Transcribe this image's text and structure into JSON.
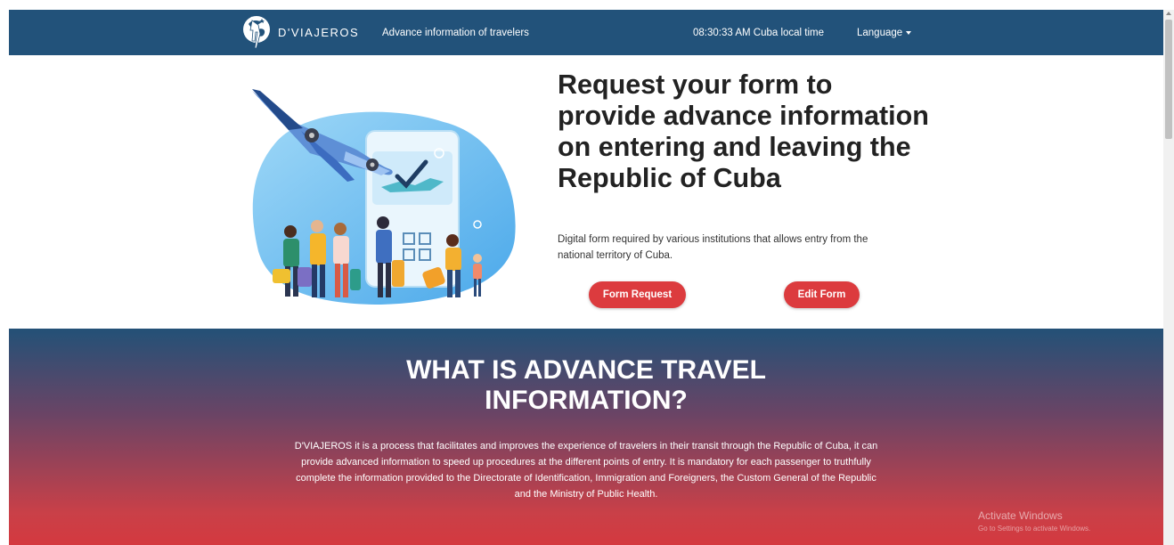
{
  "navbar": {
    "brand_name": "D'VIAJEROS",
    "tagline": "Advance information of travelers",
    "clock": "08:30:33 AM Cuba local time",
    "language_label": "Language",
    "background_color": "#22527a"
  },
  "hero": {
    "title": "Request your form to provide advance information on entering and leaving the Republic of Cuba",
    "description": "Digital form required by various institutions that allows entry from the national territory of Cuba.",
    "buttons": {
      "form_request": "Form Request",
      "edit_form": "Edit Form"
    },
    "button_color": "#dc3b3e"
  },
  "about": {
    "title": "WHAT IS ADVANCE TRAVEL INFORMATION?",
    "text": "D'VIAJEROS it is a process that facilitates and improves the experience of travelers in their transit through the Republic of Cuba, it can provide advanced information to speed up procedures at the different points of entry. It is mandatory for each passenger to truthfully complete the information provided to the Directorate of Identification, Immigration and Foreigners, the Custom General of the Republic and the Ministry of Public Health.",
    "gradient_top": "#235177",
    "gradient_bottom": "#d4393f"
  },
  "watermark": {
    "title": "Activate Windows",
    "subtitle": "Go to Settings to activate Windows."
  },
  "icons": {
    "logo": "globe-person-logo-icon",
    "language_caret": "caret-down-icon",
    "illustration": "travelers-airplane-checklist-illustration"
  }
}
